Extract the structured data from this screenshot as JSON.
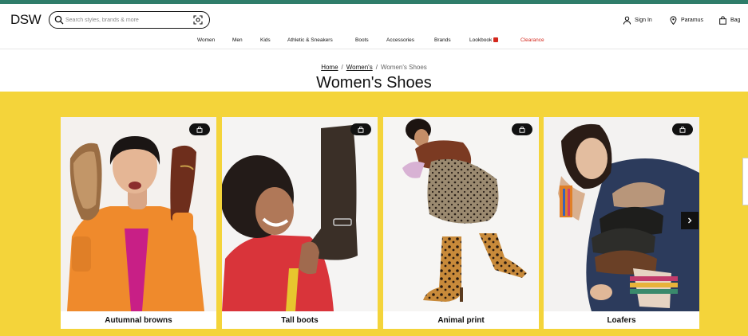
{
  "header": {
    "logo": "DSW",
    "search_placeholder": "Search styles, brands & more",
    "sign_in": "Sign In",
    "location": "Paramus",
    "bag": "Bag"
  },
  "nav": {
    "items": [
      "Women",
      "Men",
      "Kids",
      "Athletic & Sneakers",
      "Boots",
      "Accessories",
      "Brands",
      "Lookbook",
      "Clearance"
    ]
  },
  "breadcrumb": {
    "home": "Home",
    "womens": "Women's",
    "current": "Women's Shoes"
  },
  "page_title": "Women's Shoes",
  "cards": [
    {
      "label": "Autumnal browns"
    },
    {
      "label": "Tall boots"
    },
    {
      "label": "Animal print"
    },
    {
      "label": "Loafers"
    }
  ],
  "colors": {
    "accent_bar": "#2f7d6a",
    "band_yellow": "#f4d43a",
    "clearance_red": "#d4271c"
  },
  "icons": [
    "search-icon",
    "visual-search-icon",
    "user-icon",
    "location-pin-icon",
    "bag-icon",
    "save-icon",
    "chevron-right-icon",
    "lookbook-icon"
  ]
}
